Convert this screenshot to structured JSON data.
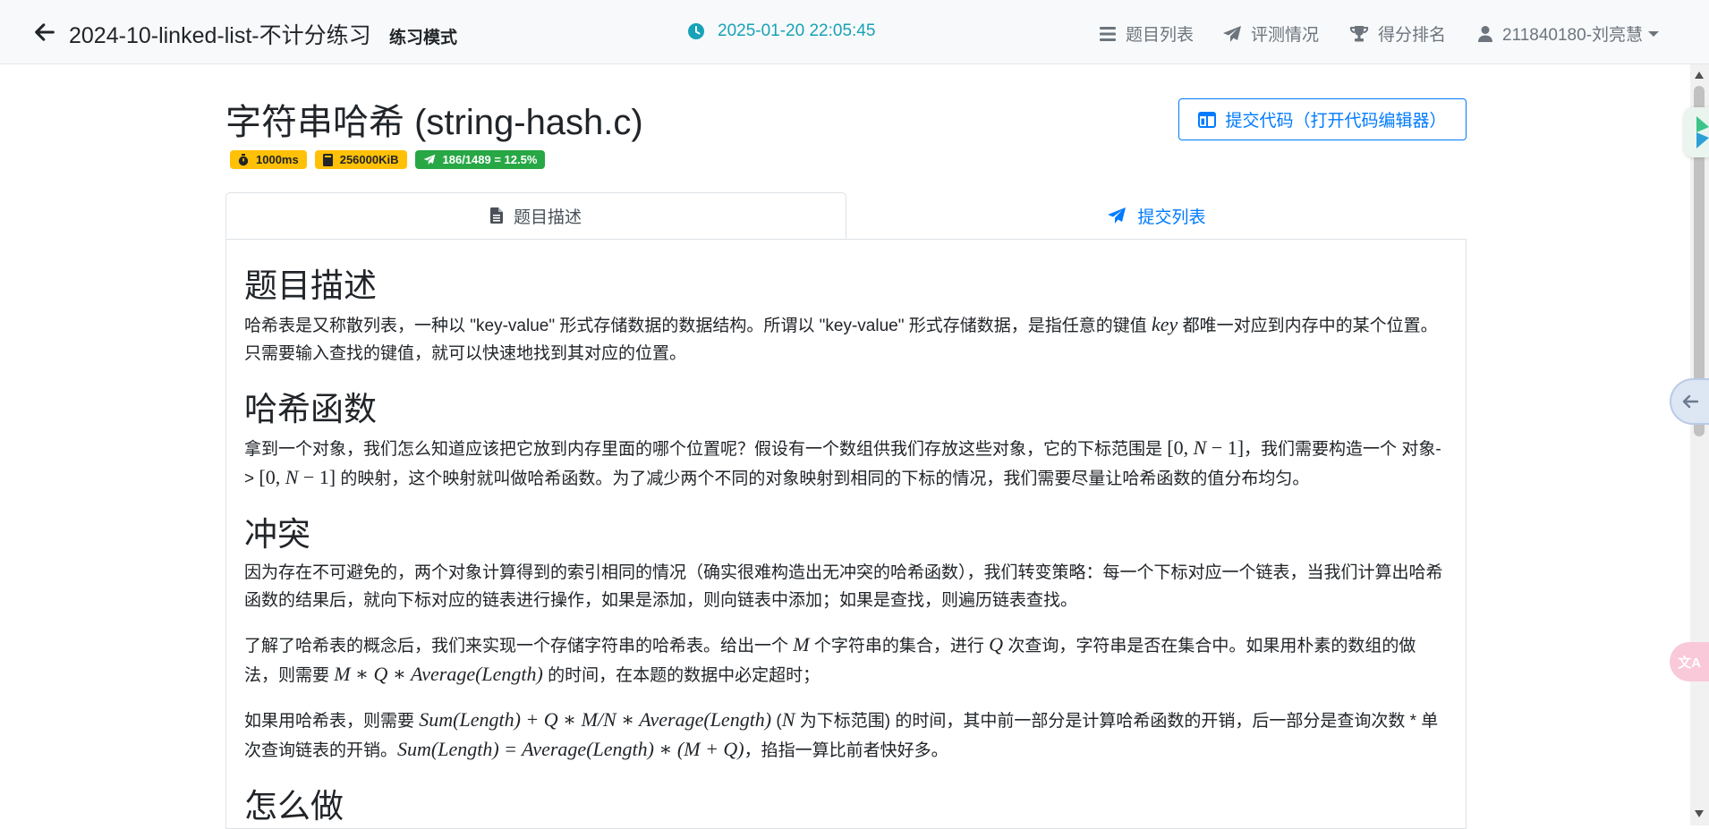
{
  "navbar": {
    "title": "2024-10-linked-list-不计分练习",
    "mode": "练习模式",
    "time": "2025-01-20 22:05:45",
    "problem_list": "题目列表",
    "judge_status": "评测情况",
    "ranking": "得分排名",
    "user": "211840180-刘亮慧"
  },
  "problem": {
    "title": "字符串哈希 (string-hash.c)",
    "time_limit": "1000ms",
    "memory_limit": "256000KiB",
    "stats": "186/1489 = 12.5%",
    "submit_label": "提交代码（打开代码编辑器）"
  },
  "tabs": {
    "description": "题目描述",
    "submissions": "提交列表"
  },
  "content": {
    "s1": {
      "title": "题目描述",
      "p1_a": "哈希表是又称散列表，一种以 \"key-value\" 形式存储数据的数据结构。所谓以 \"key-value\" 形式存储数据，是指任意的键值 ",
      "p1_m1": "key",
      "p1_b": " 都唯一对应到内存中的某个位置。只需要输入查找的键值，就可以快速地找到其对应的位置。"
    },
    "s2": {
      "title": "哈希函数",
      "p1_a": "拿到一个对象，我们怎么知道应该把它放到内存里面的哪个位置呢？假设有一个数组供我们存放这些对象，它的下标范围是 ",
      "p1_m1": "[0, ",
      "p1_m2": "N",
      "p1_m3": " − 1]",
      "p1_b": "，我们需要构造一个 对象-> ",
      "p1_m4": "[0, ",
      "p1_m5": "N",
      "p1_m6": " − 1]",
      "p1_c": " 的映射，这个映射就叫做哈希函数。为了减少两个不同的对象映射到相同的下标的情况，我们需要尽量让哈希函数的值分布均匀。"
    },
    "s3": {
      "title": "冲突",
      "p1": "因为存在不可避免的，两个对象计算得到的索引相同的情况（确实很难构造出无冲突的哈希函数），我们转变策略：每一个下标对应一个链表，当我们计算出哈希函数的结果后，就向下标对应的链表进行操作，如果是添加，则向链表中添加；如果是查找，则遍历链表查找。",
      "p2_a": "了解了哈希表的概念后，我们来实现一个存储字符串的哈希表。给出一个 ",
      "p2_m1": "M",
      "p2_b": " 个字符串的集合，进行 ",
      "p2_m2": "Q",
      "p2_c": " 次查询，字符串是否在集合中。如果用朴素的数组的做法，则需要 ",
      "p2_m3": "M ∗ Q ∗ Average(Length)",
      "p2_d": " 的时间，在本题的数据中必定超时；",
      "p3_a": "如果用哈希表，则需要 ",
      "p3_m1": "Sum(Length) + Q ∗ M/N ∗ Average(Length)",
      "p3_b": " (",
      "p3_m2": "N",
      "p3_c": " 为下标范围) 的时间，其中前一部分是计算哈希函数的开销，后一部分是查询次数 * 单次查询链表的开销。",
      "p3_m3": "Sum(Length) = Average(Length) ∗ (M + Q)",
      "p3_d": "，掐指一算比前者快好多。"
    },
    "s4": {
      "title": "怎么做"
    }
  },
  "side": {
    "translate_label": "文A"
  },
  "colors": {
    "primary": "#007bff",
    "info": "#17a2b8",
    "warning": "#ffc107",
    "success": "#28a745",
    "muted": "#6c757d"
  }
}
